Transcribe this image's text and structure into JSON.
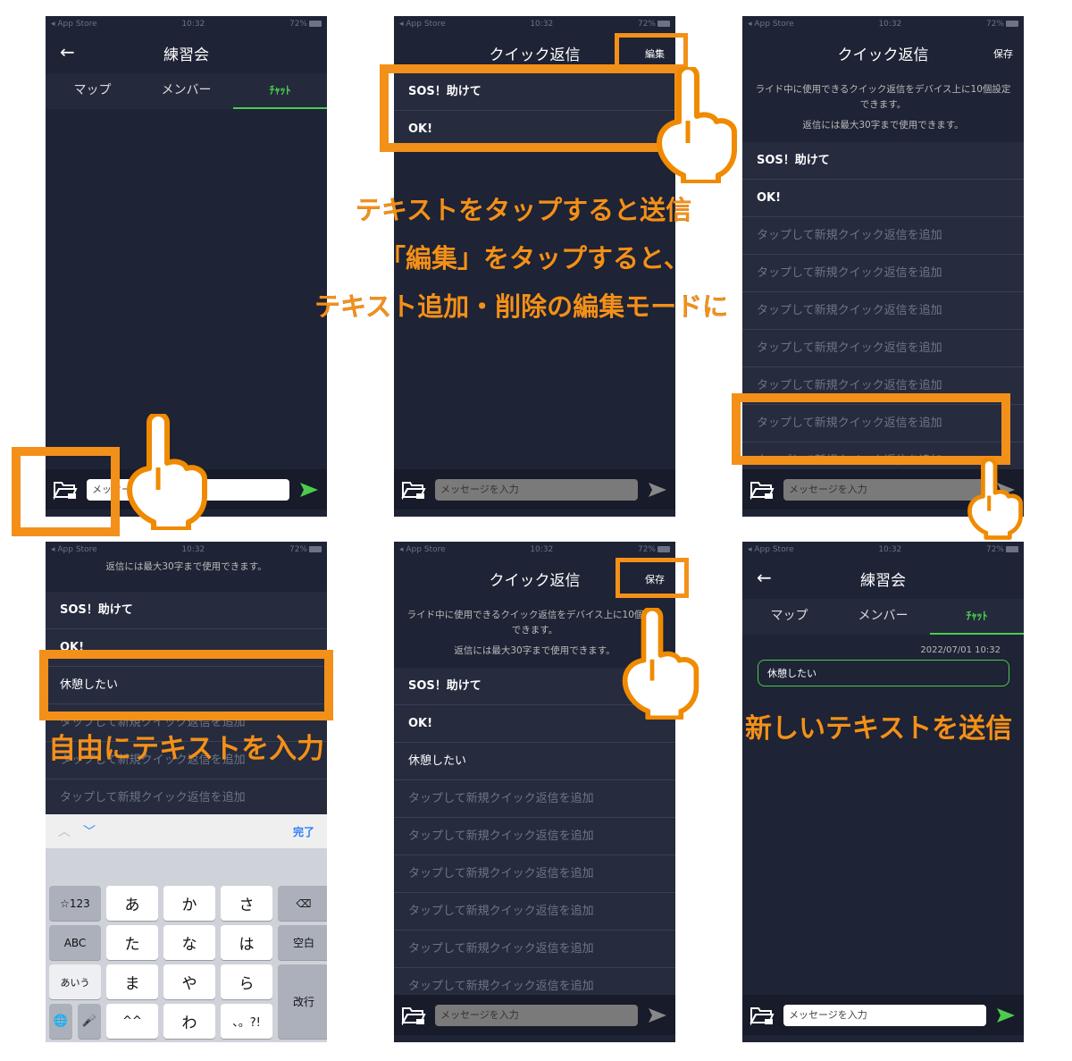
{
  "status_bar": {
    "carrier": "◂ App Store",
    "time": "10:32",
    "battery": "72%"
  },
  "chat_screen": {
    "title": "練習会",
    "back_icon": "arrow-left-icon",
    "tabs": [
      {
        "label": "マップ"
      },
      {
        "label": "メンバー"
      },
      {
        "label": "ﾁｬｯﾄ",
        "active": true
      }
    ],
    "message_placeholder": "メッセージを入力",
    "folder_icon": "folder-chat-icon",
    "send_icon": "send-arrow-icon"
  },
  "quick_reply": {
    "title": "クイック返信",
    "edit_label": "編集",
    "save_label": "保存",
    "description_line1": "ライド中に使用できるクイック返信をデバイス上に10個設定できます。",
    "description_line2": "返信には最大30字まで使用できます。",
    "items": [
      "SOS！助けて",
      "OK!"
    ],
    "added_item": "休憩したい",
    "placeholder_item": "タップして新規クイック返信を追加"
  },
  "keyboard": {
    "done_label": "完了",
    "keys": [
      "☆123",
      "あ",
      "か",
      "さ",
      "⌫",
      "ABC",
      "た",
      "な",
      "は",
      "空白",
      "あいう",
      "ま",
      "や",
      "ら",
      "改行",
      "🌐",
      "🎤",
      "^^",
      "わ",
      "、。?!"
    ]
  },
  "sent_message": {
    "timestamp": "2022/07/01 10:32",
    "text": "休憩したい"
  },
  "captions": {
    "panel2_line1": "テキストをタップすると送信",
    "panel2_line2": "「編集」をタップすると、",
    "panel2_line3": "テキスト追加・削除の編集モードに",
    "panel4": "自由にテキストを入力",
    "panel6": "新しいテキストを送信"
  },
  "colors": {
    "accent_orange": "#f39019",
    "accent_green": "#4ccc4c",
    "app_bg": "#1e2335",
    "link_blue": "#2b7ef5"
  }
}
